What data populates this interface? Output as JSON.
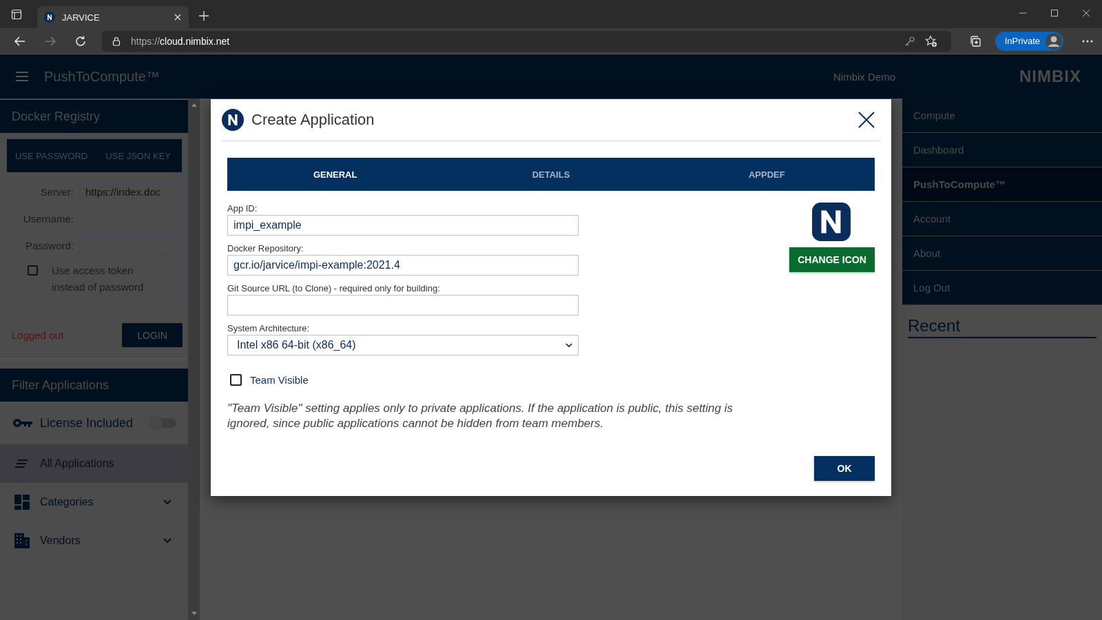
{
  "browser": {
    "tabs": [
      {
        "title": "JARVICE",
        "selected": true
      }
    ],
    "url_scheme": "https://",
    "url_host": "cloud.nimbix.net",
    "inprivate": "InPrivate"
  },
  "header": {
    "app_title": "PushToCompute™",
    "user": "Nimbix Demo",
    "logo": "NIMBIX"
  },
  "registry": {
    "title": "Docker Registry",
    "tabs": [
      {
        "label": "USE PASSWORD"
      },
      {
        "label": "USE JSON KEY"
      }
    ],
    "fields": [
      {
        "label": "Server:",
        "value": "https://index.doc"
      },
      {
        "label": "Username:"
      },
      {
        "label": "Password:"
      }
    ],
    "checkbox": {
      "label": "Use access token instead of password",
      "checked": false
    },
    "status": "Logged out",
    "login_button": "LOGIN"
  },
  "filter": {
    "title": "Filter Applications",
    "toggle": {
      "label": "License Included",
      "on": false
    },
    "items": [
      {
        "label": "All Applications",
        "selected": true,
        "kind": "link"
      },
      {
        "label": "Categories",
        "selected": false,
        "kind": "group"
      },
      {
        "label": "Vendors",
        "selected": false,
        "kind": "group"
      }
    ]
  },
  "menu": {
    "items": [
      {
        "label": "Compute",
        "selected": false
      },
      {
        "label": "Dashboard",
        "selected": false
      },
      {
        "label": "PushToCompute™",
        "selected": true
      },
      {
        "label": "Account",
        "selected": false
      },
      {
        "label": "About",
        "selected": false
      },
      {
        "label": "Log Out",
        "selected": false
      }
    ],
    "recent_title": "Recent"
  },
  "dialog": {
    "title": "Create Application",
    "tabs": [
      {
        "label": "GENERAL",
        "selected": true
      },
      {
        "label": "DETAILS",
        "selected": false
      },
      {
        "label": "APPDEF",
        "selected": false
      }
    ],
    "fields": [
      {
        "label": "App ID:",
        "value": "impi_example",
        "kind": "text"
      },
      {
        "label": "Docker Repository:",
        "value": "gcr.io/jarvice/impi-example:2021.4",
        "kind": "text"
      },
      {
        "label": "Git Source URL (to Clone) - required only for building:",
        "kind": "text"
      },
      {
        "label": "System Architecture:",
        "value": "Intel x86 64-bit (x86_64)",
        "kind": "select"
      }
    ],
    "change_icon_button": "CHANGE ICON",
    "checkbox": {
      "label": "Team Visible",
      "checked": false
    },
    "note": "\"Team Visible\" setting applies only to private applications. If the application is public, this setting is ignored, since public applications cannot be hidden from team members.",
    "ok_button": "OK"
  }
}
